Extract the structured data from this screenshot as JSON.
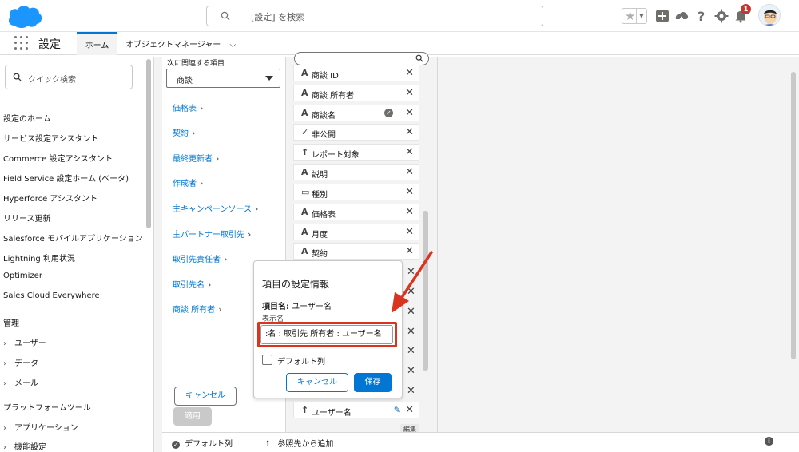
{
  "header": {
    "search_placeholder": "[設定] を検索",
    "notification_count": "1"
  },
  "appnav": {
    "app_name": "設定",
    "tabs": [
      {
        "label": "ホーム",
        "active": true
      },
      {
        "label": "オブジェクトマネージャー",
        "active": false
      }
    ]
  },
  "sidebar": {
    "quick_find_placeholder": "クイック検索",
    "items": [
      "設定のホーム",
      "サービス設定アシスタント",
      "Commerce 設定アシスタント",
      "Field Service 設定ホーム (ベータ)",
      "Hyperforce アシスタント",
      "リリース更新",
      "Salesforce モバイルアプリケーション",
      "Lightning 利用状況",
      "Optimizer",
      "Sales Cloud Everywhere"
    ],
    "section_admin": "管理",
    "admin_items": [
      "ユーザー",
      "データ",
      "メール"
    ],
    "section_platform": "プラットフォームツール",
    "platform_items": [
      "アプリケーション",
      "機能設定"
    ]
  },
  "related": {
    "label": "次に関連する項目",
    "selected": "商談",
    "links": [
      "価格表",
      "契約",
      "最終更新者",
      "作成者",
      "主キャンペーンソース",
      "主パートナー取引先",
      "取引先責任者",
      "取引先名",
      "商談 所有者"
    ],
    "cancel_label": "キャンセル",
    "apply_label": "適用"
  },
  "fields": {
    "rows": [
      {
        "icon": "A",
        "label": "商談 ID"
      },
      {
        "icon": "A",
        "label": "商談 所有者"
      },
      {
        "icon": "A",
        "label": "商談名"
      },
      {
        "icon": "✓",
        "label": "非公開"
      },
      {
        "icon": "↑",
        "label": "レポート対象"
      },
      {
        "icon": "A",
        "label": "説明"
      },
      {
        "icon": "▭",
        "label": "種別"
      },
      {
        "icon": "A",
        "label": "価格表"
      },
      {
        "icon": "A",
        "label": "月度"
      },
      {
        "icon": "A",
        "label": "契約"
      }
    ],
    "last_row": {
      "icon": "↑",
      "label": "ユーザー名"
    },
    "tooltip": "編集"
  },
  "popover": {
    "title": "項目の設定情報",
    "field_name_label": "項目名:",
    "field_name_value": "ユーザー名",
    "display_label": "表示名",
    "display_value": ":名 : 取引先 所有者 : ユーザー名",
    "default_col_label": "デフォルト列",
    "cancel_label": "キャンセル",
    "save_label": "保存"
  },
  "bottombar": {
    "default_col": "デフォルト列",
    "add_ref": "参照先から追加"
  },
  "colors": {
    "brand_blue": "#0176d3",
    "annotation_red": "#d9341f"
  }
}
